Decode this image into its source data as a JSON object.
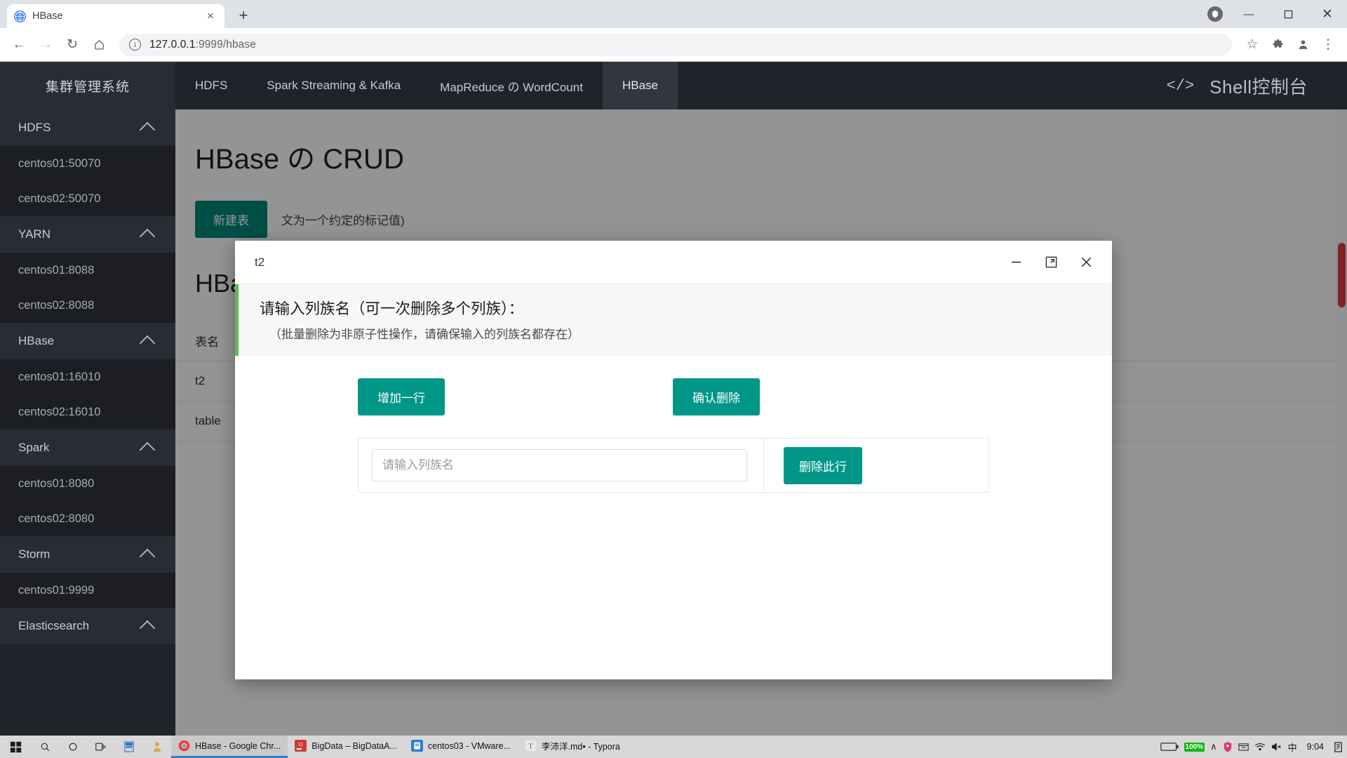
{
  "browser": {
    "tab": {
      "title": "HBase",
      "favicon": "globe-icon",
      "close": "×"
    },
    "newtab_label": "+",
    "window_controls": {
      "minimize": "—",
      "maximize": "☐",
      "close": "✕"
    },
    "toolbar": {
      "back": "←",
      "forward": "→",
      "reload": "↻",
      "home": "⌂",
      "url": "127.0.0.1:9999/hbase",
      "url_host": "127.0.0.1",
      "url_rest": ":9999/hbase",
      "star": "☆",
      "extensions": "🧩",
      "menu": "⋮"
    }
  },
  "sidebar": {
    "brand": "集群管理系统",
    "groups": [
      {
        "label": "HDFS",
        "items": [
          "centos01:50070",
          "centos02:50070"
        ]
      },
      {
        "label": "YARN",
        "items": [
          "centos01:8088",
          "centos02:8088"
        ]
      },
      {
        "label": "HBase",
        "items": [
          "centos01:16010",
          "centos02:16010"
        ]
      },
      {
        "label": "Spark",
        "items": [
          "centos01:8080",
          "centos02:8080"
        ]
      },
      {
        "label": "Storm",
        "items": [
          "centos01:9999"
        ]
      },
      {
        "label": "Elasticsearch",
        "items": []
      }
    ]
  },
  "topnav": {
    "items": [
      {
        "label": "HDFS",
        "active": false
      },
      {
        "label": "Spark Streaming & Kafka",
        "active": false
      },
      {
        "label": "MapReduce の WordCount",
        "active": false
      },
      {
        "label": "HBase",
        "active": true
      }
    ],
    "shell": {
      "icon": "</>",
      "label": "Shell控制台"
    }
  },
  "main": {
    "page_title": "HBase の CRUD",
    "create_button": "新建表",
    "hint": "文为一个约定的标记值)",
    "section_title": "HBase 表列表",
    "table": {
      "headers": [
        "表名"
      ],
      "rows": [
        [
          "t2"
        ],
        [
          "table"
        ]
      ]
    }
  },
  "modal": {
    "title": "t2",
    "controls": {
      "minimize": "minimize-icon",
      "maximize": "maximize-icon",
      "close": "close-icon"
    },
    "notice_main": "请输入列族名（可一次删除多个列族）：",
    "notice_sub": "（批量删除为非原子性操作，请确保输入的列族名都存在）",
    "add_row_button": "增加一行",
    "confirm_delete_button": "确认删除",
    "family_placeholder": "请输入列族名",
    "family_value": "",
    "delete_row_button": "删除此行"
  },
  "taskbar": {
    "start": "start-icon",
    "system_icons": [
      "search-icon",
      "cortana-icon",
      "task-view-icon",
      "calculator-icon",
      "people-icon"
    ],
    "tasks": [
      {
        "label": "HBase - Google Chr...",
        "color": "#e8453c",
        "active": true
      },
      {
        "label": "BigData – BigDataA...",
        "color": "#cc3b33",
        "active": false
      },
      {
        "label": "centos03 - VMware...",
        "color": "#2a7fd4",
        "active": false
      },
      {
        "label": "李沛洋.md• - Typora",
        "color": "#dcdcdc",
        "active": false
      }
    ],
    "tray": {
      "battery_badge": "100%",
      "chevron": "∧",
      "icons": [
        "antivirus-icon",
        "archive-icon",
        "wifi-icon",
        "volume-mute-icon",
        "ime-icon"
      ],
      "ime": "中",
      "clock": "9:04",
      "notifications": "notification-icon"
    }
  },
  "colors": {
    "accent_teal": "#009688",
    "sidebar_bg": "#20232a",
    "sidebar_header_bg": "#282c34",
    "notice_border": "#5cb85c",
    "scrollbar_thumb": "#e03b3b"
  }
}
